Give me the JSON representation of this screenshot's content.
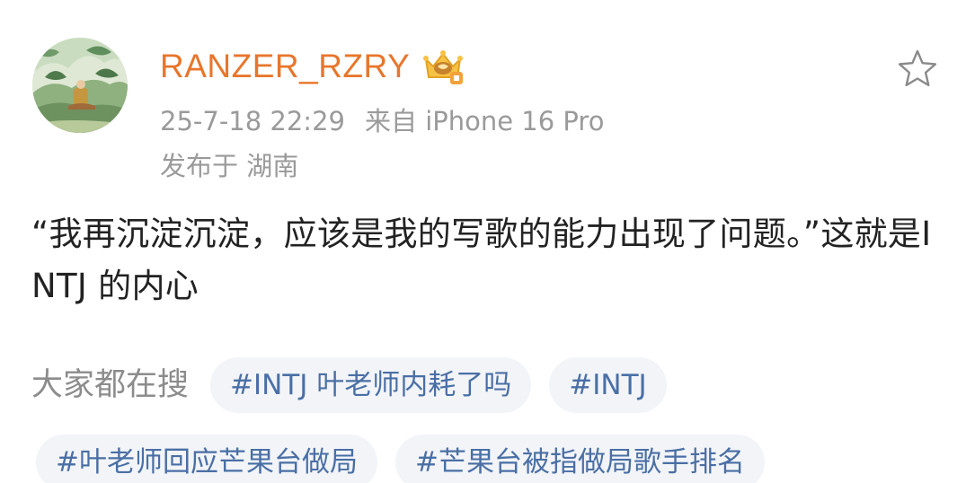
{
  "post": {
    "username": "RANZER_RZRY",
    "timestamp": "25-7-18 22:29",
    "source": "来自 iPhone 16 Pro",
    "location": "发布于 湖南",
    "content": "“我再沉淀沉淀，应该是我的写歌的能力出现了问题。”这就是INTJ 的内心"
  },
  "search": {
    "label": "大家都在搜",
    "tags": [
      "#INTJ 叶老师内耗了吗",
      "#INTJ",
      "#叶老师回应芒果台做局",
      "#芒果台被指做局歌手排名"
    ]
  },
  "icons": {
    "avatar": "painting-avatar",
    "badge": "vip-crown-badge-icon",
    "favorite": "star-outline-icon"
  },
  "colors": {
    "username": "#e8762c",
    "meta": "#9a9a9a",
    "tag_text": "#4a6fa5",
    "tag_bg": "#f2f4f8",
    "body_text": "#222222"
  }
}
